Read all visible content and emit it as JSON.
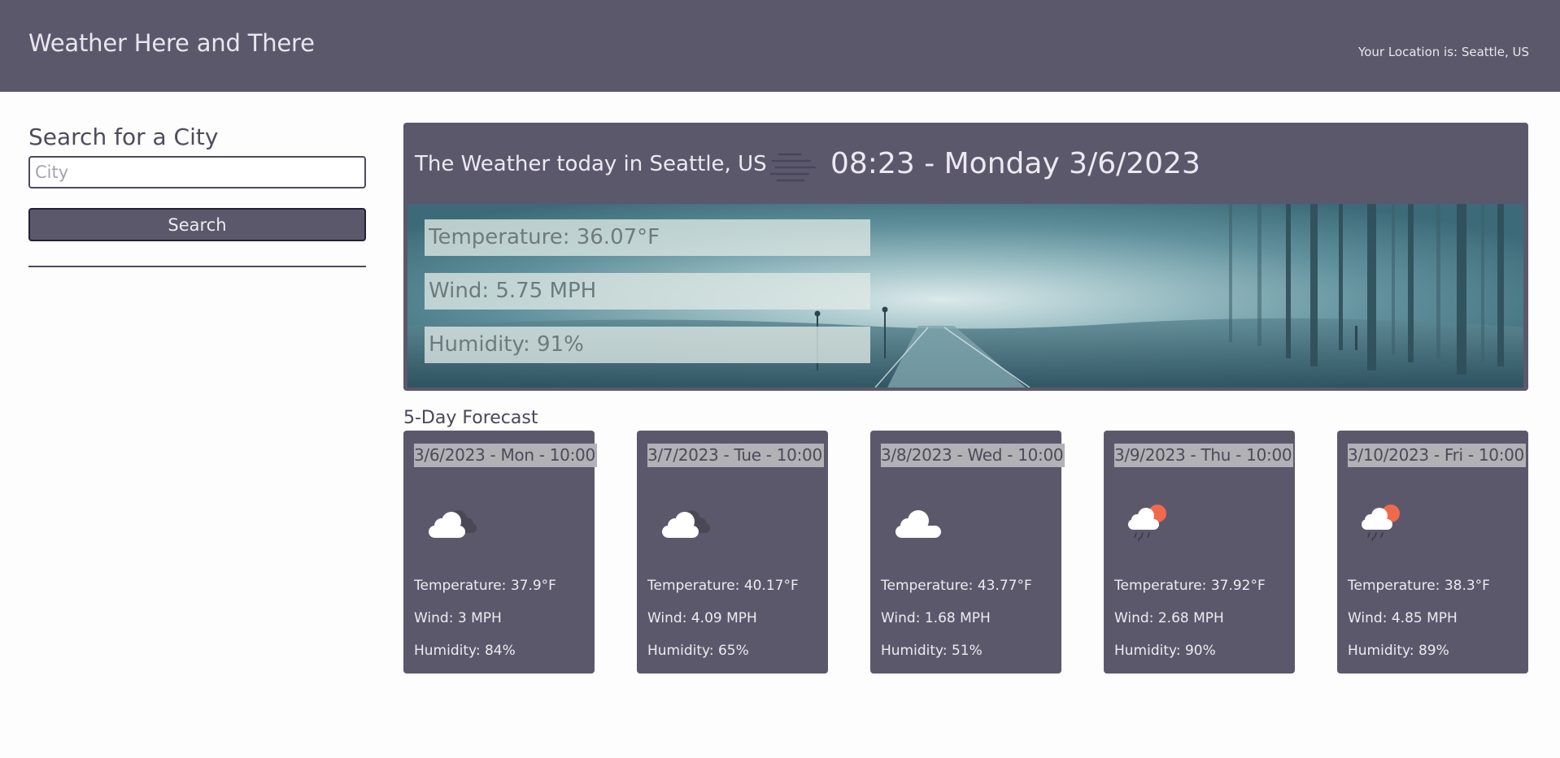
{
  "header": {
    "app_title": "Weather Here and There",
    "location_text": "Your Location is: Seattle, US"
  },
  "sidebar": {
    "search_heading": "Search for a City",
    "city_input": {
      "placeholder": "City",
      "value": ""
    },
    "search_button_label": "Search"
  },
  "today": {
    "title": "The Weather today in Seattle, US",
    "icon": "fog-icon",
    "datetime": "08:23 - Monday 3/6/2023",
    "temperature": "Temperature: 36.07°F",
    "wind": "Wind: 5.75 MPH",
    "humidity": "Humidity: 91%"
  },
  "forecast": {
    "heading": "5-Day Forecast",
    "days": [
      {
        "date": "3/6/2023 - Mon - 10:00",
        "icon": "cloudy-icon",
        "temperature": "Temperature: 37.9°F",
        "wind": "Wind: 3 MPH",
        "humidity": "Humidity: 84%"
      },
      {
        "date": "3/7/2023 - Tue - 10:00",
        "icon": "cloudy-icon",
        "temperature": "Temperature: 40.17°F",
        "wind": "Wind: 4.09 MPH",
        "humidity": "Humidity: 65%"
      },
      {
        "date": "3/8/2023 - Wed - 10:00",
        "icon": "cloud-icon",
        "temperature": "Temperature: 43.77°F",
        "wind": "Wind: 1.68 MPH",
        "humidity": "Humidity: 51%"
      },
      {
        "date": "3/9/2023 - Thu - 10:00",
        "icon": "sun-rain-icon",
        "temperature": "Temperature: 37.92°F",
        "wind": "Wind: 2.68 MPH",
        "humidity": "Humidity: 90%"
      },
      {
        "date": "3/10/2023 - Fri - 10:00",
        "icon": "sun-rain-icon",
        "temperature": "Temperature: 38.3°F",
        "wind": "Wind: 4.85 MPH",
        "humidity": "Humidity: 89%"
      }
    ]
  },
  "colors": {
    "primary": "#5c586c",
    "header_text": "#e9e6ee",
    "date_highlight": "#b2b1b6",
    "sun": "#ef6a4c"
  }
}
